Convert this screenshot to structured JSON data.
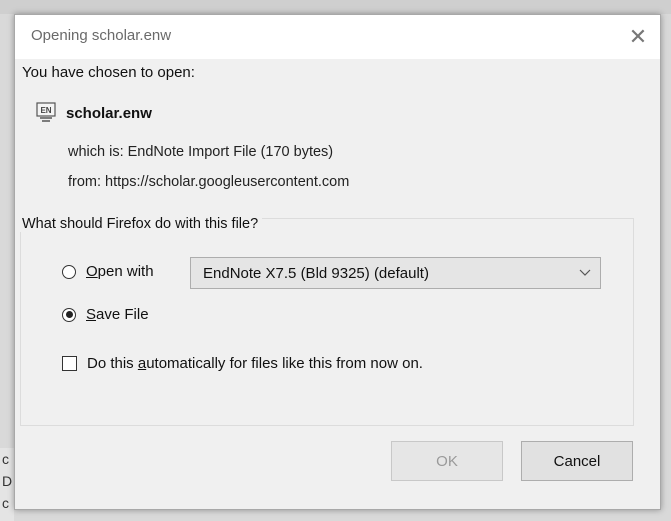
{
  "dialog": {
    "title": "Opening scholar.enw",
    "close_glyph": "✕",
    "chosen_label": "You have chosen to open:",
    "file": {
      "icon": "endnote-file-icon",
      "icon_text": "EN",
      "name": "scholar.enw"
    },
    "which_is": "which is:  EndNote Import File (170 bytes)",
    "from": "from:  https://scholar.googleusercontent.com",
    "group_legend": "What should Firefox do with this file?",
    "open_with": {
      "label_first": "O",
      "label_rest": "pen with",
      "selected": false
    },
    "app_select": {
      "value": "EndNote X7.5 (Bld 9325) (default)",
      "arrow": "⌄"
    },
    "save_file": {
      "label_first": "S",
      "label_rest": "ave File",
      "selected": true
    },
    "auto": {
      "label_before": "Do this ",
      "label_u": "a",
      "label_after": "utomatically for files like this from now on.",
      "checked": false
    },
    "buttons": {
      "ok": "OK",
      "cancel": "Cancel"
    }
  },
  "backdrop": {
    "fragments": [
      "c",
      "D",
      "c"
    ]
  }
}
